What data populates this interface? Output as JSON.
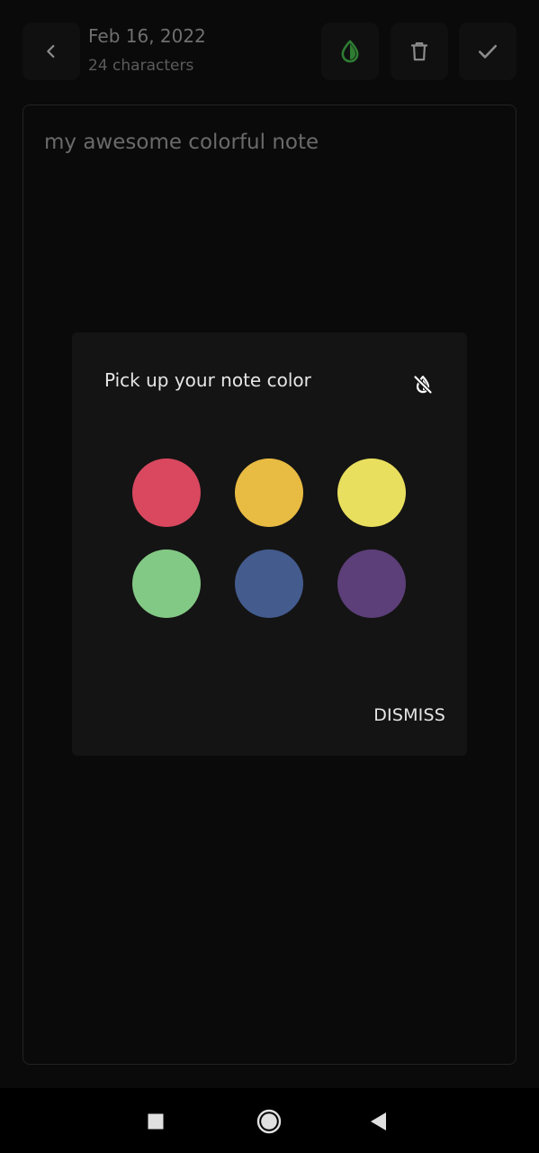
{
  "header": {
    "date": "Feb 16, 2022",
    "char_count": "24 characters"
  },
  "note": {
    "body": "my awesome colorful note"
  },
  "dialog": {
    "title": "Pick up your note color",
    "dismiss_label": "DISMISS",
    "colors": [
      "#d9485f",
      "#e8bb42",
      "#e9df5e",
      "#82c985",
      "#445b8e",
      "#5c3e78"
    ]
  },
  "theme": {
    "accent": "#2e7d32",
    "background": "#0a0a0a"
  },
  "icons": {
    "back": "chevron-left-icon",
    "color": "contrast-drop-icon",
    "delete": "trash-icon",
    "save": "checkmark-icon",
    "no_color": "invert-colors-off-icon"
  }
}
